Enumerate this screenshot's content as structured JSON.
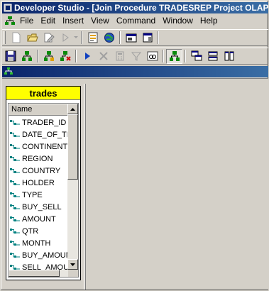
{
  "window": {
    "title": "Developer Studio - [Join  Procedure TRADESREP  Project OLAP]"
  },
  "menu": [
    "File",
    "Edit",
    "Insert",
    "View",
    "Command",
    "Window",
    "Help"
  ],
  "toolbar1": {
    "icons": [
      "new-icon",
      "open-icon",
      "save-as-icon",
      "run-icon",
      "procedure-icon",
      "web-icon",
      "window-icon",
      "document-icon"
    ]
  },
  "toolbar2": {
    "icons": [
      "save-icon",
      "join-icon",
      "join-add-icon",
      "join-remove-icon",
      "run-icon",
      "delete-icon",
      "calculator-icon",
      "filter-icon",
      "link-icon",
      "join-view-icon",
      "layout-cascade-icon",
      "layout-horizontal-icon",
      "layout-vertical-icon"
    ]
  },
  "table": {
    "name": "trades",
    "column_header": "Name",
    "fields": [
      "TRADER_ID",
      "DATE_OF_TR",
      "CONTINENT",
      "REGION",
      "COUNTRY",
      "HOLDER",
      "TYPE",
      "BUY_SELL",
      "AMOUNT",
      "QTR",
      "MONTH",
      "BUY_AMOUNT",
      "SELL_AMOUN"
    ]
  },
  "colors": {
    "title_bar": "#0a246a",
    "table_title_bg": "#ffff00",
    "face": "#d4d0c8"
  }
}
